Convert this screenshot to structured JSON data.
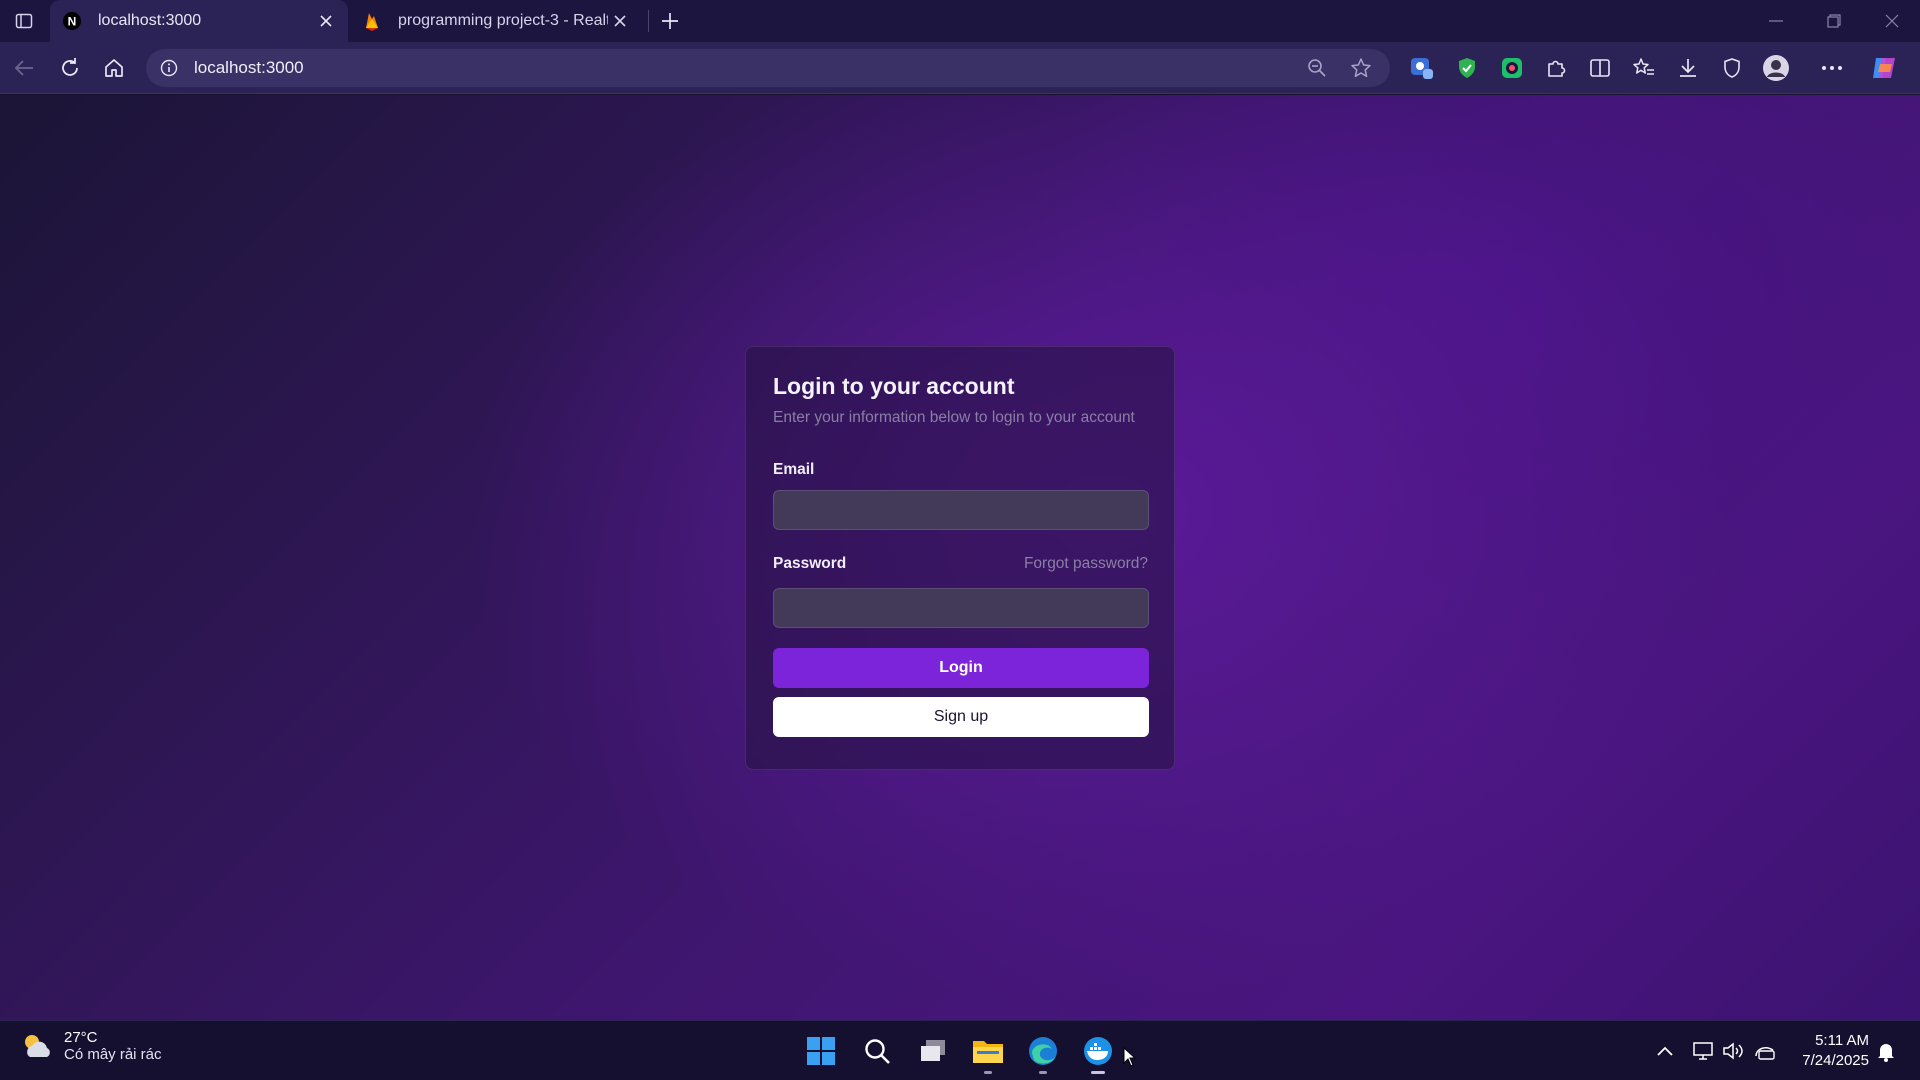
{
  "browser": {
    "tabs": [
      {
        "title": "localhost:3000",
        "favicon": "n-favicon",
        "active": true
      },
      {
        "title": "programming project-3 - Realtim",
        "favicon": "firebase-favicon",
        "active": false
      }
    ],
    "address_bar": {
      "url": "localhost:3000"
    },
    "toolbar_icons": [
      "back-icon",
      "refresh-icon",
      "home-icon",
      "zoom-out-icon",
      "star-icon",
      "extension-1-icon",
      "shield-check-icon",
      "extension-2-icon",
      "puzzle-icon",
      "split-screen-icon",
      "favorites-icon",
      "download-icon",
      "browser-essentials-icon",
      "profile-avatar",
      "more-icon",
      "copilot-icon"
    ]
  },
  "login": {
    "title": "Login to your account",
    "description": "Enter your information below to login to your account",
    "email_label": "Email",
    "email_value": "",
    "password_label": "Password",
    "password_value": "",
    "forgot_label": "Forgot password?",
    "login_button": "Login",
    "signup_button": "Sign up"
  },
  "taskbar": {
    "weather": {
      "temp": "27°C",
      "condition": "Có mây rải rác"
    },
    "apps": [
      "windows-start-icon",
      "search-icon",
      "task-view-icon",
      "file-explorer-icon",
      "edge-icon",
      "docker-icon"
    ],
    "clock": {
      "time": "5:11 AM",
      "date": "7/24/2025"
    }
  },
  "colors": {
    "accent": "#7b24d9",
    "titlebar": "#1b1540",
    "toolbar": "#2b2356"
  }
}
